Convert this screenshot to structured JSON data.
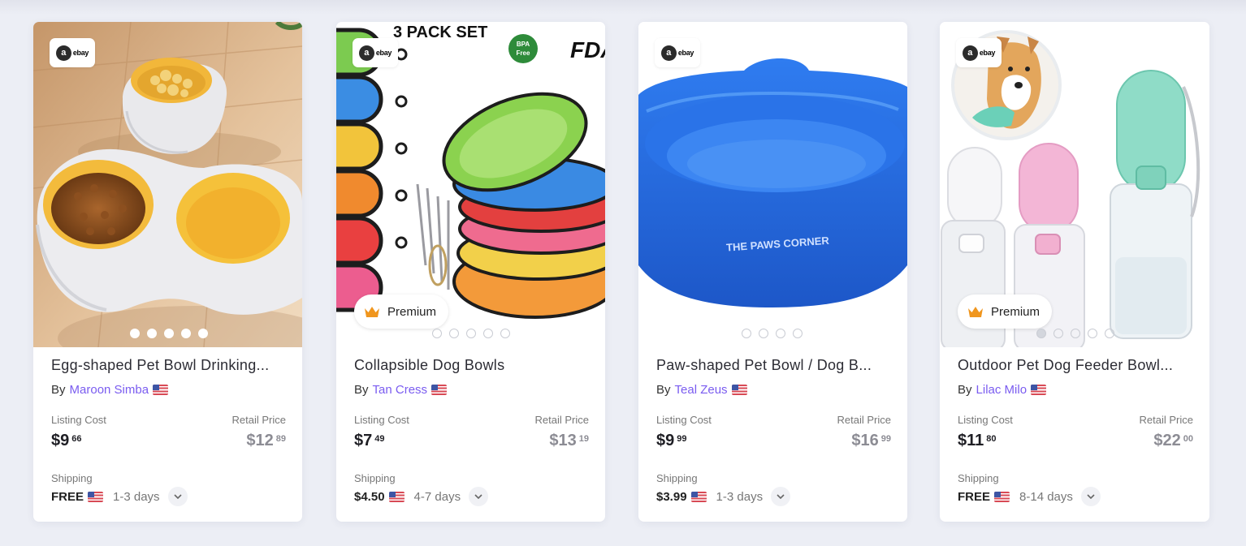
{
  "colors": {
    "page_bg": "#eceef5",
    "card_bg": "#ffffff",
    "seller_link": "#7a5cf0",
    "premium_crown": "#f0961e",
    "bowl_blue": "#2b6ee6"
  },
  "products": [
    {
      "title": "Egg-shaped Pet Bowl Drinking...",
      "by": "By",
      "seller": "Maroon Simba",
      "listing_cost_label": "Listing Cost",
      "listing_dollars": "$9",
      "listing_cents": "66",
      "retail_price_label": "Retail Price",
      "retail_dollars": "$12",
      "retail_cents": "89",
      "shipping_label": "Shipping",
      "shipping_cost": "FREE",
      "shipping_days": "1-3 days",
      "store_badge": "ebay",
      "image_count": 5
    },
    {
      "title": "Collapsible Dog Bowls",
      "by": "By",
      "seller": "Tan Cress",
      "listing_cost_label": "Listing Cost",
      "listing_dollars": "$7",
      "listing_cents": "49",
      "retail_price_label": "Retail Price",
      "retail_dollars": "$13",
      "retail_cents": "19",
      "shipping_label": "Shipping",
      "shipping_cost": "$4.50",
      "shipping_days": "4-7 days",
      "store_badge": "ebay",
      "premium_label": "Premium",
      "image_text_pack": "3 PACK SET",
      "image_text_bpa_1": "BPA",
      "image_text_bpa_2": "Free",
      "image_text_fda": "FDA",
      "image_count": 5
    },
    {
      "title": "Paw-shaped Pet Bowl / Dog B...",
      "by": "By",
      "seller": "Teal Zeus",
      "listing_cost_label": "Listing Cost",
      "listing_dollars": "$9",
      "listing_cents": "99",
      "retail_price_label": "Retail Price",
      "retail_dollars": "$16",
      "retail_cents": "99",
      "shipping_label": "Shipping",
      "shipping_cost": "$3.99",
      "shipping_days": "1-3 days",
      "store_badge": "ebay",
      "image_text_brand": "THE PAWS CORNER",
      "image_count": 4
    },
    {
      "title": "Outdoor Pet Dog Feeder Bowl...",
      "by": "By",
      "seller": "Lilac Milo",
      "listing_cost_label": "Listing Cost",
      "listing_dollars": "$11",
      "listing_cents": "80",
      "retail_price_label": "Retail Price",
      "retail_dollars": "$22",
      "retail_cents": "00",
      "shipping_label": "Shipping",
      "shipping_cost": "FREE",
      "shipping_days": "8-14 days",
      "store_badge": "ebay",
      "premium_label": "Premium",
      "image_count": 5
    }
  ]
}
